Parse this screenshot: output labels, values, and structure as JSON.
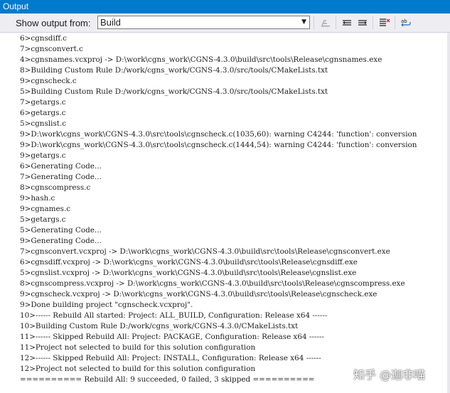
{
  "window": {
    "title": "Output"
  },
  "toolbar": {
    "show_output_label": "Show output from:",
    "source_selected": "Build",
    "icons": [
      "find-message-in-code-icon",
      "go-to-previous-message-icon",
      "go-to-next-message-icon",
      "clear-all-icon",
      "toggle-word-wrap-icon"
    ]
  },
  "output": {
    "lines": [
      "6>cgnsdiff.c",
      "7>cgnsconvert.c",
      "4>cgnsnames.vcxproj -> D:\\work\\cgns_work\\CGNS-4.3.0\\build\\src\\tools\\Release\\cgnsnames.exe",
      "8>Building Custom Rule D:/work/cgns_work/CGNS-4.3.0/src/tools/CMakeLists.txt",
      "9>cgnscheck.c",
      "5>Building Custom Rule D:/work/cgns_work/CGNS-4.3.0/src/tools/CMakeLists.txt",
      "7>getargs.c",
      "6>getargs.c",
      "5>cgnslist.c",
      "9>D:\\work\\cgns_work\\CGNS-4.3.0\\src\\tools\\cgnscheck.c(1035,60): warning C4244: 'function': conversion",
      "9>D:\\work\\cgns_work\\CGNS-4.3.0\\src\\tools\\cgnscheck.c(1444,54): warning C4244: 'function': conversion",
      "9>getargs.c",
      "6>Generating Code...",
      "7>Generating Code...",
      "8>cgnscompress.c",
      "9>hash.c",
      "9>cgnames.c",
      "5>getargs.c",
      "5>Generating Code...",
      "9>Generating Code...",
      "7>cgnsconvert.vcxproj -> D:\\work\\cgns_work\\CGNS-4.3.0\\build\\src\\tools\\Release\\cgnsconvert.exe",
      "6>cgnsdiff.vcxproj -> D:\\work\\cgns_work\\CGNS-4.3.0\\build\\src\\tools\\Release\\cgnsdiff.exe",
      "5>cgnslist.vcxproj -> D:\\work\\cgns_work\\CGNS-4.3.0\\build\\src\\tools\\Release\\cgnslist.exe",
      "8>cgnscompress.vcxproj -> D:\\work\\cgns_work\\CGNS-4.3.0\\build\\src\\tools\\Release\\cgnscompress.exe",
      "9>cgnscheck.vcxproj -> D:\\work\\cgns_work\\CGNS-4.3.0\\build\\src\\tools\\Release\\cgnscheck.exe",
      "9>Done building project \"cgnscheck.vcxproj\".",
      "10>------ Rebuild All started: Project: ALL_BUILD, Configuration: Release x64 ------",
      "10>Building Custom Rule D:/work/cgns_work/CGNS-4.3.0/CMakeLists.txt",
      "11>------ Skipped Rebuild All: Project: PACKAGE, Configuration: Release x64 ------",
      "11>Project not selected to build for this solution configuration",
      "12>------ Skipped Rebuild All: Project: INSTALL, Configuration: Release x64 ------",
      "12>Project not selected to build for this solution configuration",
      "========== Rebuild All: 9 succeeded, 0 failed, 3 skipped =========="
    ]
  },
  "watermark": {
    "text": "知乎 @迦非喵"
  },
  "colors": {
    "title_bar": "#007acc",
    "toolbar_bg": "#eeeef2",
    "output_bg": "#ffffff"
  }
}
